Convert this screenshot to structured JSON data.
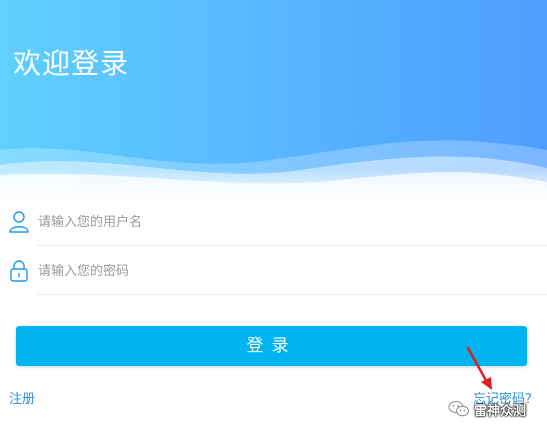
{
  "header": {
    "title": "欢迎登录"
  },
  "form": {
    "username_placeholder": "请输入您的用户名",
    "username_value": "",
    "password_placeholder": "请输入您的密码",
    "password_value": "",
    "login_label": "登录"
  },
  "links": {
    "register": "注册",
    "forgot": "忘记密码？"
  },
  "watermark": {
    "text": "雷神众测"
  },
  "colors": {
    "accent": "#00b5ef",
    "link": "#2a8fe0",
    "header_start": "#5cc8ff",
    "header_end": "#4aa3ff",
    "annotation_arrow": "#e02020"
  }
}
